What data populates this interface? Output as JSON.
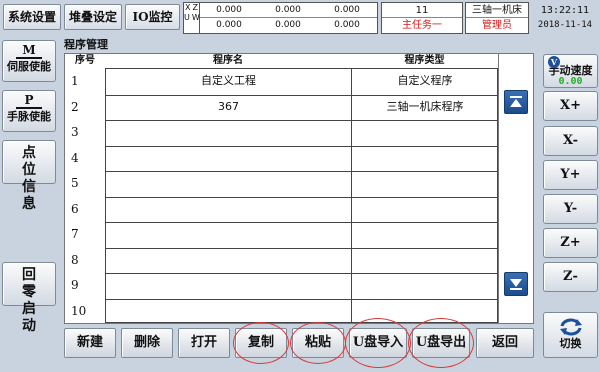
{
  "header": {
    "system_settings": "系统设置",
    "stack_settings": "堆叠设定",
    "io_monitor": "IO监控",
    "coords": {
      "axis_labels": [
        "X",
        "Z",
        "U",
        "W"
      ],
      "row1": [
        "0.000",
        "0.000",
        "0.000"
      ],
      "row2": [
        "0.000",
        "0.000",
        "0.000"
      ]
    },
    "status": {
      "count": "11",
      "task": "主任务一"
    },
    "mode": {
      "machine": "三轴一机床",
      "role": "管理员"
    },
    "clock": {
      "time": "13:22:11",
      "date": "2018-11-14"
    }
  },
  "left_panel": {
    "servo": {
      "icon_letter": "M",
      "label": "伺服使能"
    },
    "pulse": {
      "icon_letter": "P",
      "label": "手脉使能"
    },
    "point_info": {
      "line1": "点 位",
      "line2": "信 息"
    },
    "return_home": {
      "line1": "回 零",
      "line2": "启 动"
    }
  },
  "program_table": {
    "title": "程序管理",
    "columns": {
      "index": "序号",
      "name": "程序名",
      "type": "程序类型"
    },
    "rows": [
      {
        "index": "1",
        "name": "自定义工程",
        "type": "自定义程序"
      },
      {
        "index": "2",
        "name": "367",
        "type": "三轴一机床程序"
      },
      {
        "index": "3",
        "name": "",
        "type": ""
      },
      {
        "index": "4",
        "name": "",
        "type": ""
      },
      {
        "index": "5",
        "name": "",
        "type": ""
      },
      {
        "index": "6",
        "name": "",
        "type": ""
      },
      {
        "index": "7",
        "name": "",
        "type": ""
      },
      {
        "index": "8",
        "name": "",
        "type": ""
      },
      {
        "index": "9",
        "name": "",
        "type": ""
      },
      {
        "index": "10",
        "name": "",
        "type": ""
      }
    ],
    "scroll_top_icon": "scroll-top-icon",
    "scroll_bottom_icon": "scroll-bottom-icon"
  },
  "right_panel": {
    "speed": {
      "icon_letter": "V",
      "label": "手动速度",
      "value": "0.00"
    },
    "jog_buttons": [
      "X+",
      "X-",
      "Y+",
      "Y-",
      "Z+",
      "Z-"
    ],
    "switch": {
      "icon": "cycle-arrows-icon",
      "label": "切换"
    }
  },
  "bottom_bar": {
    "buttons": [
      "新建",
      "删除",
      "打开",
      "复制",
      "粘贴",
      "U盘导入",
      "U盘导出",
      "返回"
    ],
    "highlight_color": "#d83b3b"
  }
}
